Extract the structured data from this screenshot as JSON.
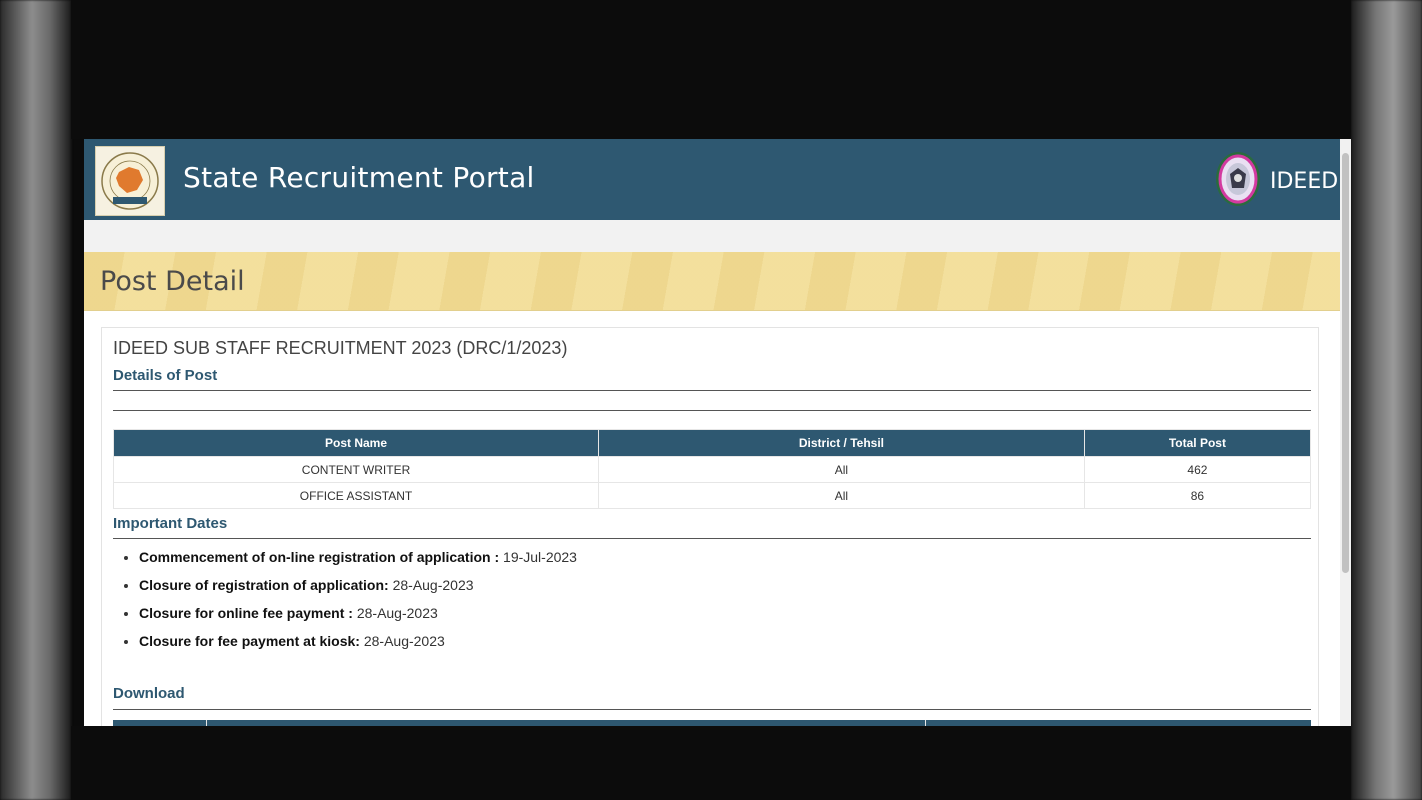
{
  "header": {
    "portal_title": "State Recruitment Portal",
    "brand": "IDEED",
    "logo_icon": "rajasthan-map-seal-icon",
    "emblem_icon": "ideed-emblem-icon",
    "colors": {
      "header": "#2e5871",
      "banner": "#f1df9f"
    }
  },
  "page": {
    "heading": "Post Detail"
  },
  "recruitment": {
    "title": "IDEED SUB STAFF RECRUITMENT 2023 (DRC/1/2023)",
    "details_title": "Details of Post",
    "table": {
      "headers": [
        "Post Name",
        "District / Tehsil",
        "Total Post"
      ],
      "rows": [
        [
          "CONTENT WRITER",
          "All",
          "462"
        ],
        [
          "OFFICE ASSISTANT",
          "All",
          "86"
        ]
      ]
    },
    "dates_title": "Important Dates",
    "dates": [
      {
        "label": "Commencement of on-line registration of application :",
        "value": "19-Jul-2023"
      },
      {
        "label": "Closure of registration of application:",
        "value": "28-Aug-2023"
      },
      {
        "label": "Closure for online fee payment :",
        "value": "28-Aug-2023"
      },
      {
        "label": "Closure for fee payment at kiosk:",
        "value": "28-Aug-2023"
      }
    ],
    "download_title": "Download"
  }
}
